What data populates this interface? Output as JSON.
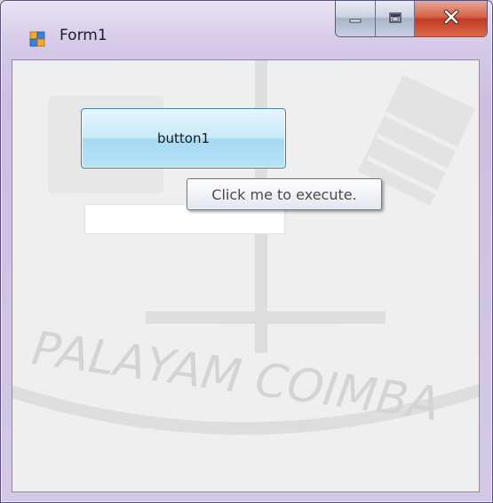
{
  "window": {
    "title": "Form1",
    "icon": "form-icon",
    "caption_buttons": [
      "minimize-icon",
      "maximize-icon",
      "close-icon"
    ]
  },
  "form": {
    "button_label": "button1",
    "textbox_value": "",
    "tooltip_text": "Click me to execute."
  },
  "background_watermark": {
    "text": "PALAYAM  COIMBA"
  },
  "colors": {
    "button_border": "#3c7fb1",
    "close_button": "#c13b22",
    "title_bar": "#cdbfe3"
  }
}
